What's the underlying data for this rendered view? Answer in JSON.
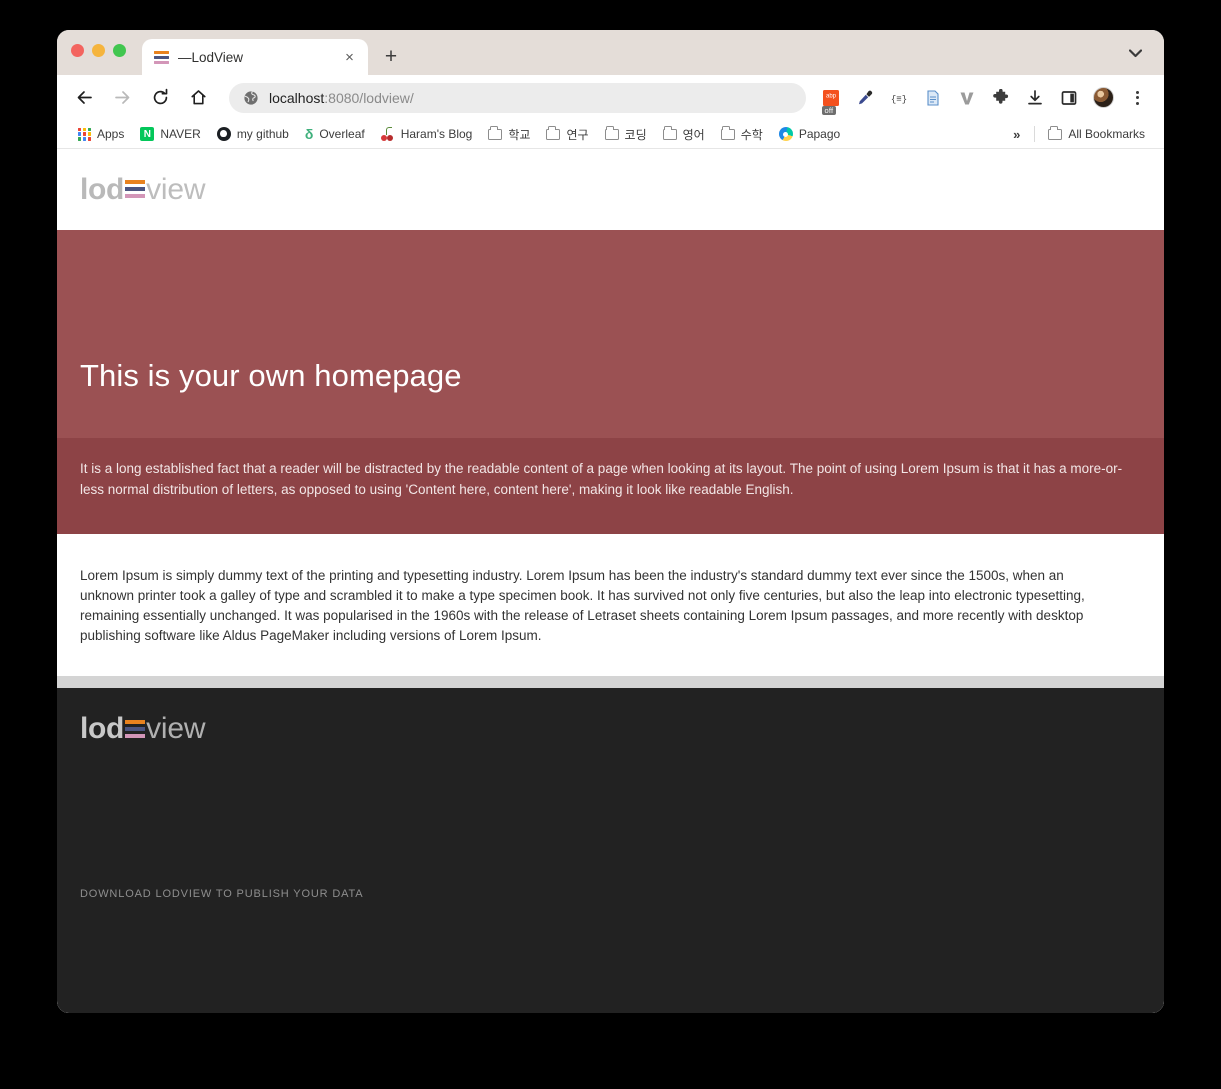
{
  "browser": {
    "tab": {
      "title": "—LodView",
      "favicon_name": "lodview-favicon",
      "close_label": "×"
    },
    "new_tab_label": "+",
    "tabstrip_chevron": "⌄",
    "nav": {
      "back": "←",
      "forward": "→",
      "reload": "↻",
      "home": "⌂"
    },
    "omnibox": {
      "url_host": "localhost",
      "url_rest": ":8080/lodview/",
      "full_url": "localhost:8080/lodview/"
    },
    "toolbar_icons": [
      {
        "name": "adblock-extension-icon",
        "badge": "off"
      },
      {
        "name": "eyedropper-extension-icon",
        "badge": ""
      },
      {
        "name": "json-viewer-extension-icon",
        "badge": ""
      },
      {
        "name": "reader-mode-icon",
        "badge": ""
      },
      {
        "name": "vimium-extension-icon",
        "badge": ""
      },
      {
        "name": "puzzle-extensions-icon",
        "badge": ""
      },
      {
        "name": "downloads-icon",
        "badge": ""
      },
      {
        "name": "side-panel-icon",
        "badge": ""
      },
      {
        "name": "profile-avatar-icon",
        "badge": ""
      },
      {
        "name": "chrome-menu-kebab-icon",
        "badge": ""
      }
    ],
    "bookmarks": [
      {
        "label": "Apps",
        "icon": "apps-grid-icon"
      },
      {
        "label": "NAVER",
        "icon": "naver-icon"
      },
      {
        "label": "my github",
        "icon": "github-icon"
      },
      {
        "label": "Overleaf",
        "icon": "overleaf-icon"
      },
      {
        "label": "Haram's Blog",
        "icon": "cherry-icon"
      },
      {
        "label": "학교",
        "icon": "folder-icon"
      },
      {
        "label": "연구",
        "icon": "folder-icon"
      },
      {
        "label": "코딩",
        "icon": "folder-icon"
      },
      {
        "label": "영어",
        "icon": "folder-icon"
      },
      {
        "label": "수학",
        "icon": "folder-icon"
      },
      {
        "label": "Papago",
        "icon": "papago-icon"
      }
    ],
    "bookmarks_overflow": "»",
    "all_bookmarks_label": "All Bookmarks"
  },
  "site": {
    "logo": {
      "word_left": "lod",
      "word_right": "view",
      "bar_colors": [
        "#e8821e",
        "#4b5480",
        "#d396b8"
      ]
    },
    "hero": {
      "heading": "This is your own homepage",
      "subtext": "It is a long established fact that a reader will be distracted by the readable content of a page when looking at its layout. The point of using Lorem Ipsum is that it has a more-or-less normal distribution of letters, as opposed to using 'Content here, content here', making it look like readable English.",
      "bg_color": "#9b5153",
      "sub_bg_color": "#8d4346"
    },
    "body": {
      "paragraph": "Lorem Ipsum is simply dummy text of the printing and typesetting industry. Lorem Ipsum has been the industry's standard dummy text ever since the 1500s, when an unknown printer took a galley of type and scrambled it to make a type specimen book. It has survived not only five centuries, but also the leap into electronic typesetting, remaining essentially unchanged. It was popularised in the 1960s with the release of Letraset sheets containing Lorem Ipsum passages, and more recently with desktop publishing software like Aldus PageMaker including versions of Lorem Ipsum."
    },
    "footer": {
      "download_text": "DOWNLOAD LODVIEW TO PUBLISH YOUR DATA",
      "bg_color": "#222222"
    }
  }
}
